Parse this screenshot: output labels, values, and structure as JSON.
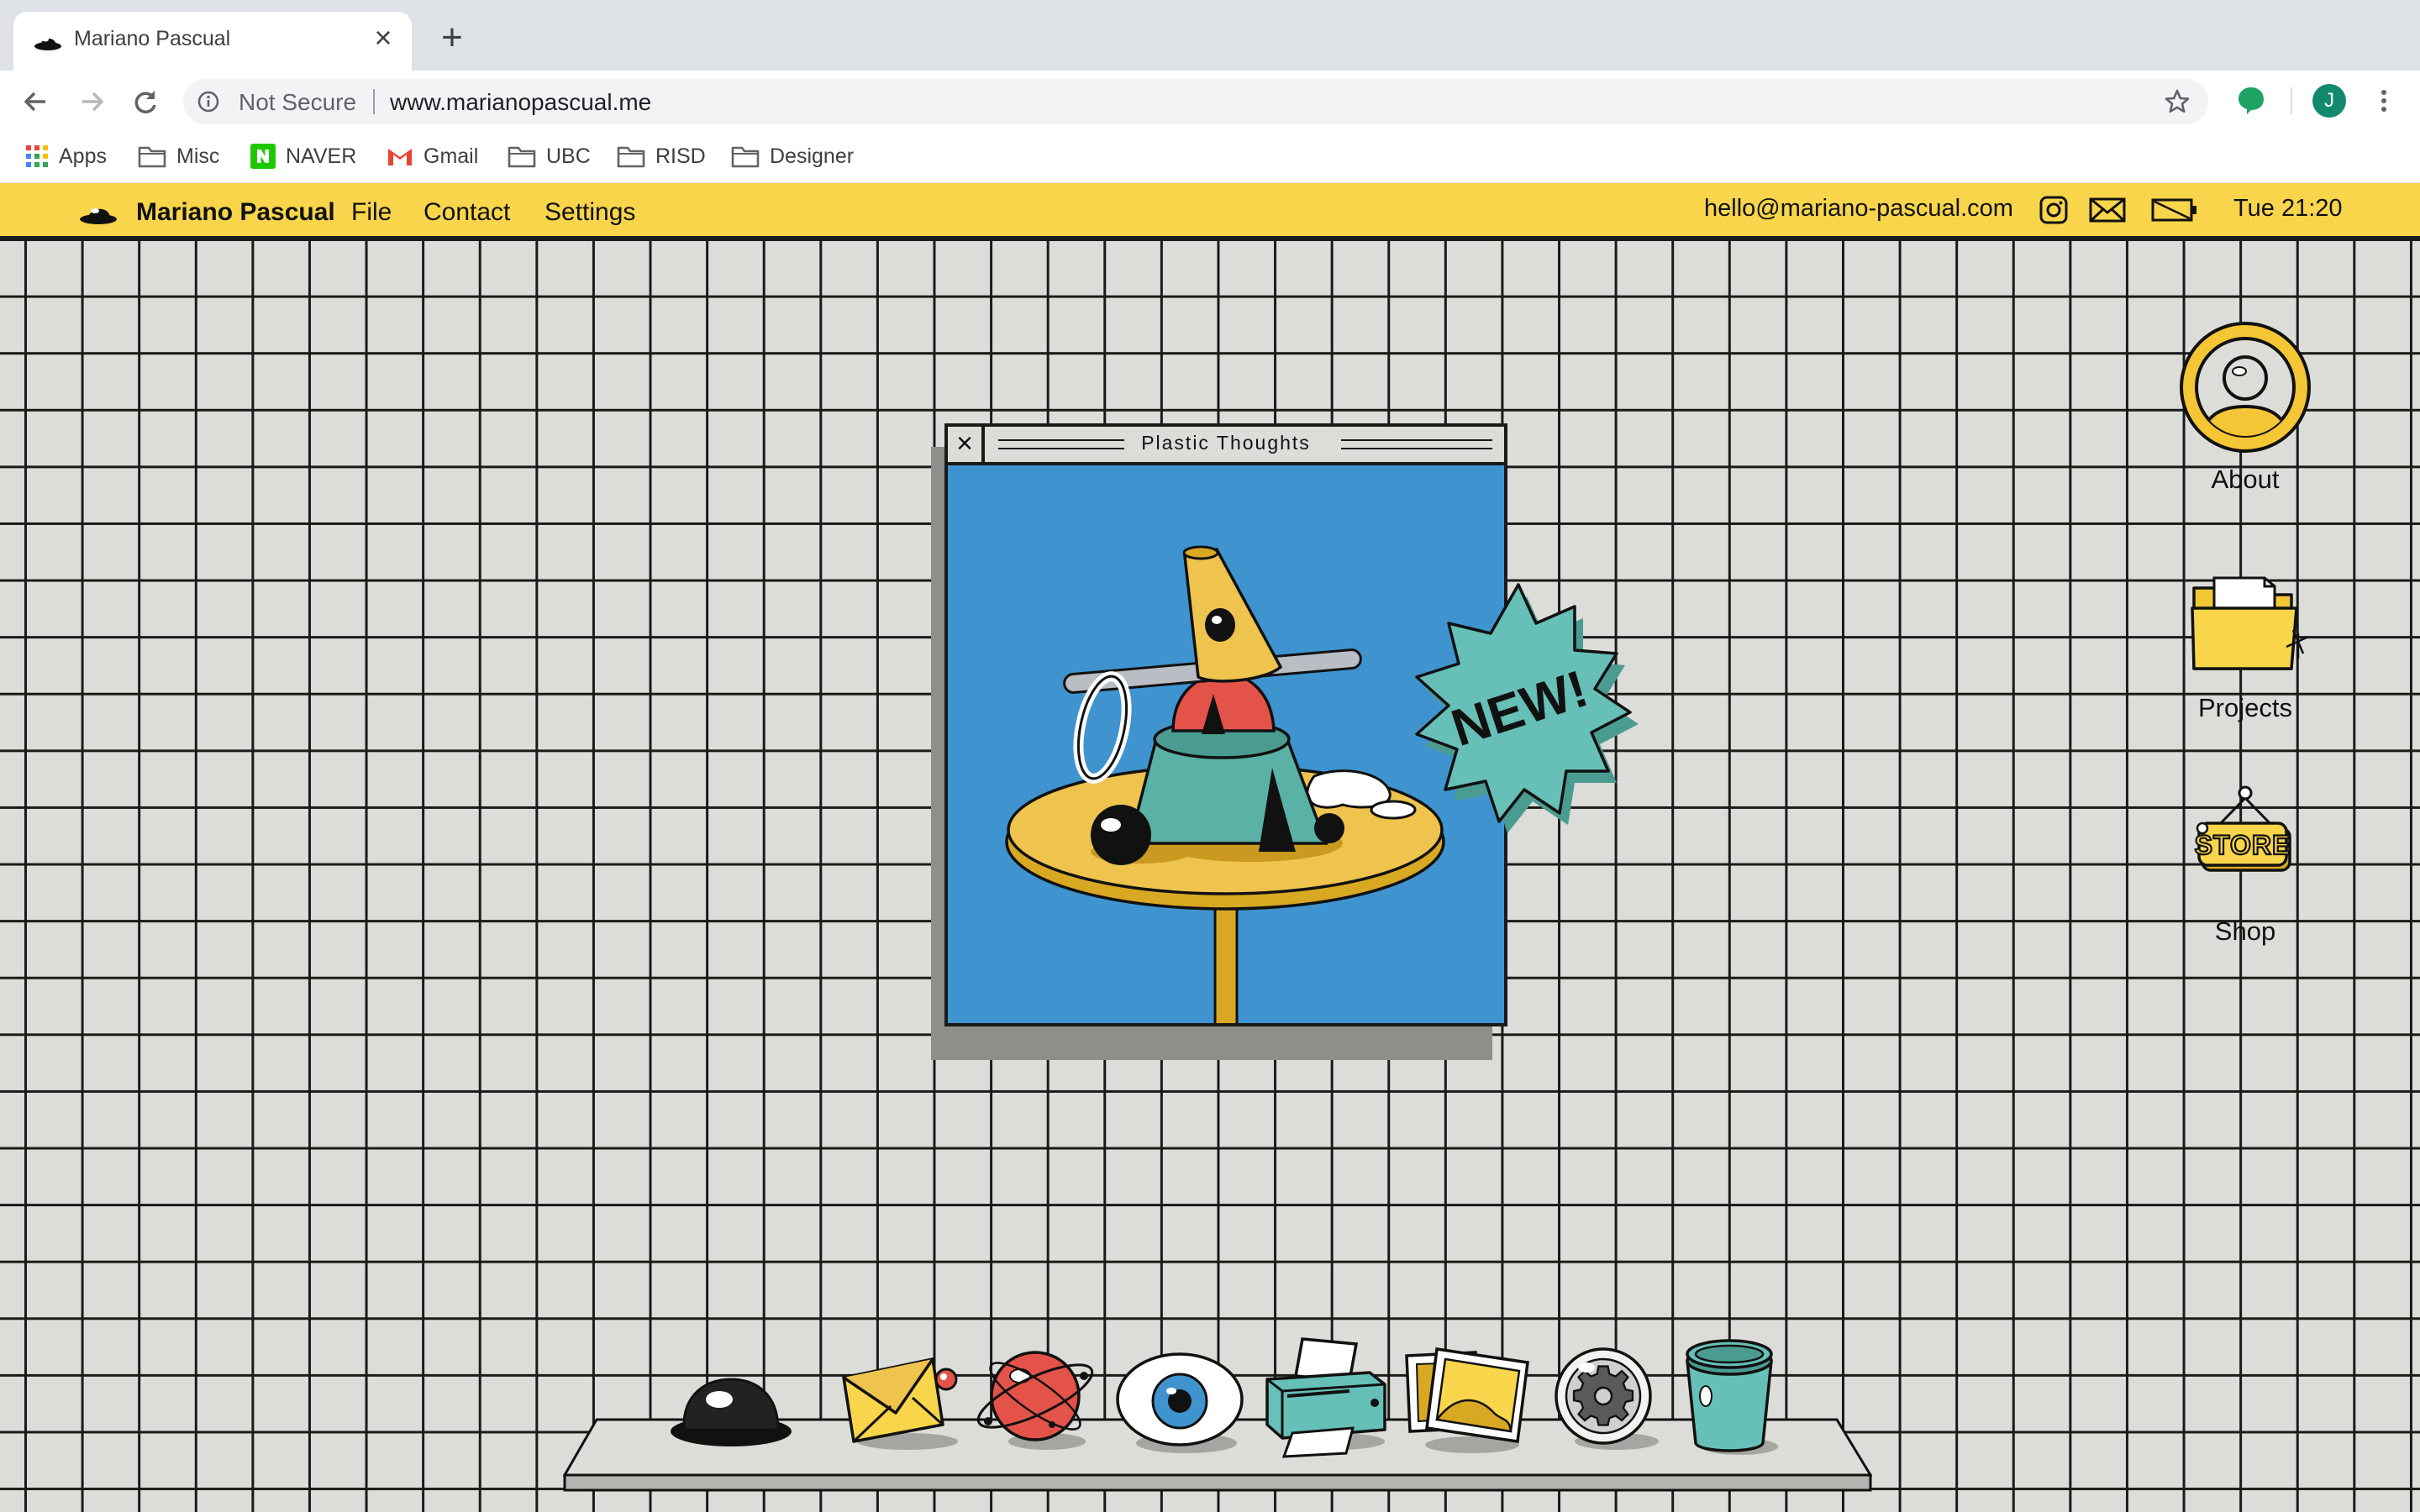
{
  "browser": {
    "tab_title": "Mariano Pascual",
    "tab_close": "×",
    "new_tab": "+",
    "security_label": "Not Secure",
    "url": "www.marianopascual.me",
    "profile_initial": "J",
    "icons": [
      "back-icon",
      "forward-icon",
      "reload-icon",
      "info-icon",
      "star-icon",
      "extension-icon",
      "menu-icon"
    ]
  },
  "bookmarks": [
    {
      "label": "Apps",
      "icon": "apps-grid-icon"
    },
    {
      "label": "Misc",
      "icon": "folder-icon"
    },
    {
      "label": "NAVER",
      "icon": "naver-icon"
    },
    {
      "label": "Gmail",
      "icon": "gmail-icon"
    },
    {
      "label": "UBC",
      "icon": "folder-icon"
    },
    {
      "label": "RISD",
      "icon": "folder-icon"
    },
    {
      "label": "Designer",
      "icon": "folder-icon"
    }
  ],
  "menubar": {
    "brand": "Mariano Pascual",
    "items": [
      "File",
      "Contact",
      "Settings"
    ],
    "email": "hello@mariano-pascual.com",
    "clock": "Tue 21:20",
    "status_icons": [
      "instagram-icon",
      "mail-icon",
      "battery-icon"
    ],
    "accent_color": "#f8d54a"
  },
  "desktop_icons": [
    {
      "label": "About",
      "icon": "avatar-icon"
    },
    {
      "label": "Projects",
      "icon": "folder-icon"
    },
    {
      "label": "Shop",
      "icon": "store-sign-icon",
      "sign_text": "STORE"
    }
  ],
  "window": {
    "title": "Plastic Thoughts",
    "close": "×",
    "background_color": "#3f94cf",
    "badge": "NEW!"
  },
  "dock": [
    {
      "name": "hole-icon"
    },
    {
      "name": "mail-icon"
    },
    {
      "name": "planet-icon"
    },
    {
      "name": "eye-icon"
    },
    {
      "name": "printer-icon"
    },
    {
      "name": "photos-icon"
    },
    {
      "name": "settings-gear-icon"
    },
    {
      "name": "trash-bucket-icon"
    }
  ]
}
